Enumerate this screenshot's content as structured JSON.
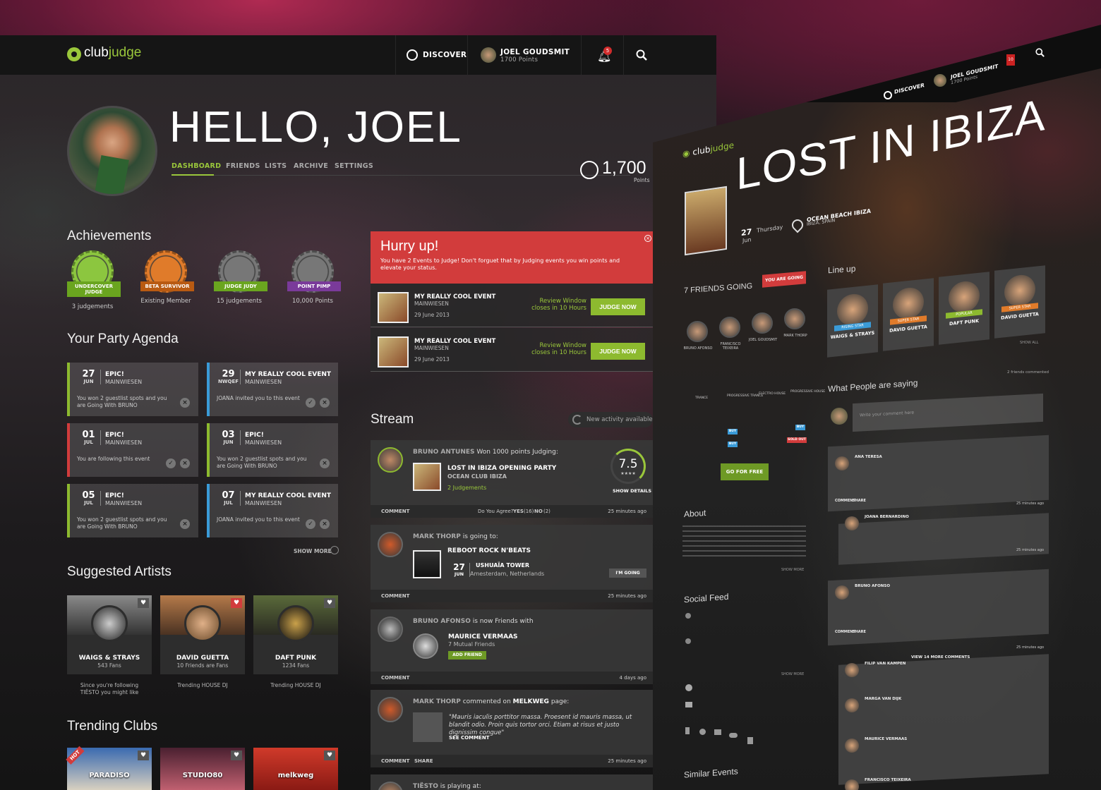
{
  "nav": {
    "logo_a": "club",
    "logo_b": "judge",
    "discover": "DISCOVER",
    "user_name": "JOEL GOUDSMIT",
    "user_points": "1700 Points",
    "notif_count": "5"
  },
  "profile": {
    "greeting": "HELLO, JOEL",
    "tabs": [
      "DASHBOARD",
      "FRIENDS",
      "LISTS",
      "ARCHIVE",
      "SETTINGS"
    ],
    "points": "1,700",
    "points_label": "Points"
  },
  "achievements": {
    "title": "Achievements",
    "items": [
      {
        "label": "UNDERCOVER JUDGE",
        "caption": "3 judgements",
        "color": "#8cc63f",
        "ribbon": "#6aa51f"
      },
      {
        "label": "BETA SURVIVOR",
        "caption": "Existing Member",
        "color": "#e07b2a",
        "ribbon": "#b85a12"
      },
      {
        "label": "JUDGE JUDY",
        "caption": "15 judgements",
        "color": "#777777",
        "ribbon": "#6aa51f"
      },
      {
        "label": "POINT PIMP",
        "caption": "10,000 Points",
        "color": "#777777",
        "ribbon": "#7a3a9a"
      }
    ]
  },
  "agenda": {
    "title": "Your Party Agenda",
    "show_more": "SHOW MORE",
    "items": [
      {
        "day": "27",
        "month": "JUN",
        "title": "EPIC!",
        "venue": "MAINWIESEN",
        "note": "You won 2 guestlist spots and you are Going With BRUNO",
        "color": "#8dba2f",
        "check": false
      },
      {
        "day": "29",
        "month": "NWQEF",
        "title": "MY REALLY COOL EVENT",
        "venue": "MAINWIESEN",
        "note": "JOANA invited you to this event",
        "color": "#3a9bd8",
        "check": true
      },
      {
        "day": "01",
        "month": "JUL",
        "title": "EPIC!",
        "venue": "MAINWIESEN",
        "note": "You are following this event",
        "color": "#d23c3c",
        "check": true
      },
      {
        "day": "03",
        "month": "JUN",
        "title": "EPIC!",
        "venue": "MAINWIESEN",
        "note": "You won 2 guestlist spots and you are Going With BRUNO",
        "color": "#8dba2f",
        "check": false
      },
      {
        "day": "05",
        "month": "JUL",
        "title": "EPIC!",
        "venue": "MAINWIESEN",
        "note": "You won 2 guestlist spots and you are Going With BRUNO",
        "color": "#8dba2f",
        "check": false
      },
      {
        "day": "07",
        "month": "JUL",
        "title": "MY REALLY COOL EVENT",
        "venue": "MAINWIESEN",
        "note": "JOANA invited you to this event",
        "color": "#3a9bd8",
        "check": true
      }
    ]
  },
  "artists": {
    "title": "Suggested Artists",
    "items": [
      {
        "name": "WAIGS & STRAYS",
        "fans": "543 Fans",
        "cap1": "Since you're following",
        "cap2": "TIËSTO you might like",
        "liked": false
      },
      {
        "name": "DAVID GUETTA",
        "fans": "10 Friends are Fans",
        "cap1": "Trending HOUSE DJ",
        "cap2": "",
        "liked": true
      },
      {
        "name": "DAFT PUNK",
        "fans": "1234 Fans",
        "cap1": "Trending HOUSE DJ",
        "cap2": "",
        "liked": false
      }
    ]
  },
  "clubs": {
    "title": "Trending Clubs",
    "items": [
      "PARADISO",
      "STUDIO80",
      "melkweg"
    ],
    "hot": "HOT"
  },
  "hurry": {
    "title": "Hurry up!",
    "text": "You have 2 Events to Judge! Don't forguet that by Judging events you win points and elevate your status.",
    "close": "×",
    "rows": [
      {
        "title": "MY REALLY COOL EVENT",
        "venue": "MAINWIESEN",
        "date": "29 June 2013",
        "window": "Review Window closes in 10 Hours",
        "btn": "JUDGE NOW"
      },
      {
        "title": "MY REALLY COOL EVENT",
        "venue": "MAINWIESEN",
        "date": "29 June 2013",
        "window": "Review Window closes in 10 Hours",
        "btn": "JUDGE NOW"
      }
    ]
  },
  "stream": {
    "title": "Stream",
    "new_activity": "New activity available",
    "c1": {
      "user": "BRUNO ANTUNES",
      "action": "Won 1000 points Judging:",
      "event": "LOST IN IBIZA OPENING PARTY",
      "venue": "OCEAN CLUB IBIZA",
      "judgements": "2 Judgements",
      "score": "7.5",
      "stars": "★★★★",
      "details": "SHOW DETAILS",
      "comment": "COMMENT",
      "agree": "Do You Agree?",
      "yes": "YES",
      "yes_n": "(16)",
      "no": "NO",
      "no_n": "(2)",
      "time": "25 minutes ago"
    },
    "c2": {
      "user": "MARK THORP",
      "action": "is going to:",
      "event": "REBOOT ROCK N'BEATS",
      "day": "27",
      "month": "JUN",
      "venue": "USHUAÏA TOWER",
      "place": "Amesterdam, Netherlands",
      "btn": "I'M GOING",
      "comment": "COMMENT",
      "time": "25 minutes ago"
    },
    "c3": {
      "user": "BRUNO AFONSO",
      "action": "is now Friends with",
      "friend": "MAURICE VERMAAS",
      "mutual": "7 Mutual Friends",
      "btn": "ADD FRIEND",
      "comment": "COMMENT",
      "time": "4 days ago"
    },
    "c4": {
      "user": "MARK THORP",
      "action": "commented on",
      "page": "MELKWEG",
      "page_suffix": "page:",
      "quote": "\"Mauris iaculis porttitor massa. Proesent id mauris massa, ut blandit odio. Proin quis tortor orci. Etiam at risus et justo dignissim congue\"",
      "see": "SEE COMMENT",
      "comment": "COMMENT",
      "share": "SHARE",
      "time": "25 minutes ago"
    },
    "c5": {
      "user": "TIËSTO",
      "action": "is playing at:"
    }
  },
  "ibiza": {
    "logo_a": "club",
    "logo_b": "judge",
    "discover": "DISCOVER",
    "user_name": "JOEL GOUDSMIT",
    "user_points": "1700 Points",
    "notif": "10",
    "title": "LOST IN IBIZA",
    "day": "27",
    "month": "Jun",
    "weekday": "Thursday",
    "venue": "OCEAN BEACH IBIZA",
    "place": "IBIZA, SPAIN",
    "friends_title": "7 FRIENDS GOING",
    "going_btn": "YOU ARE GOING",
    "friends": [
      "BRUNO AFONSO",
      "FRANCISCO TEIXEIRA",
      "JOEL GOUDSMIT",
      "MARK THORP"
    ],
    "genres": [
      "TRANCE",
      "PROGRESSIVE TRANCE",
      "ELECTRO HOUSE",
      "PROGRESSIVE HOUSE"
    ],
    "buy": "BUY",
    "sold_out": "SOLD OUT",
    "free_btn": "GO FOR FREE",
    "lineup_title": "Line up",
    "lineup": [
      {
        "name": "WAIGS & STRAYS",
        "tag": "RISING STAR",
        "tag_color": "#3a9bd8"
      },
      {
        "name": "DAVID GUETTA",
        "tag": "SUPER STAR",
        "tag_color": "#e07b2a"
      },
      {
        "name": "DAFT PUNK",
        "tag": "POPULAR",
        "tag_color": "#8dba2f"
      },
      {
        "name": "DAVID GUETTA",
        "tag": "SUPER STAR",
        "tag_color": "#e07b2a"
      }
    ],
    "show_all": "SHOW ALL",
    "saying": "What People are saying",
    "friends_commented": "2 friends commented",
    "comment_ph": "Write your comment here",
    "commenters": [
      "ANA TERESA",
      "JOANA BERNARDINO",
      "BRUNO AFONSO",
      "FILIP VAN KAMPEN",
      "MARGA VAN DIJK",
      "MAURICE VERMAAS",
      "FRANCISCO TEIXEIRA"
    ],
    "comment_lbl": "COMMENT",
    "share_lbl": "SHARE",
    "view_more": "VIEW 14 MORE COMMENTS",
    "time": "25 minutes ago",
    "about": "About",
    "social": "Social Feed",
    "show_more": "SHOW MORE",
    "similar": "Similar Events"
  }
}
